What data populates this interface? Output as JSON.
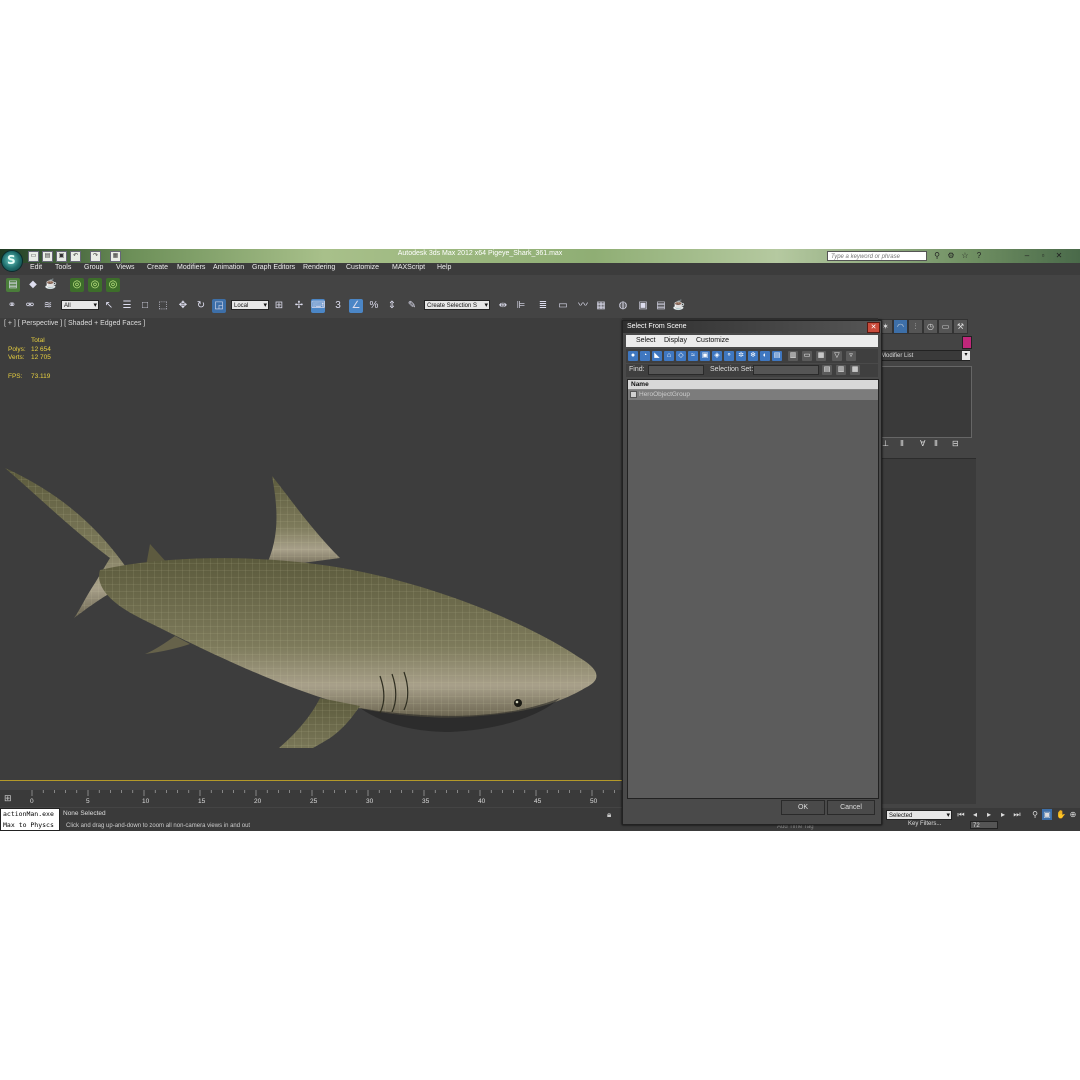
{
  "window": {
    "title": "Autodesk 3ds Max  2012 x64      Pigeye_Shark_361.max",
    "search_placeholder": "Type a keyword or phrase"
  },
  "menu": [
    "Edit",
    "Tools",
    "Group",
    "Views",
    "Create",
    "Modifiers",
    "Animation",
    "Graph Editors",
    "Rendering",
    "Customize",
    "MAXScript",
    "Help"
  ],
  "toolbar": {
    "filter_value": "All",
    "coord_value": "Local",
    "selection_set_placeholder": "Create Selection S"
  },
  "viewport": {
    "label": "[ + ] [ Perspective ] [ Shaded + Edged Faces ]",
    "stats": {
      "total_label": "Total",
      "polys_label": "Polys:",
      "polys_value": "12 654",
      "verts_label": "Verts:",
      "verts_value": "12 705",
      "fps_label": "FPS:",
      "fps_value": "73.119"
    }
  },
  "command_panel": {
    "modifier_list": "Modifier List"
  },
  "dialog": {
    "title": "Select From Scene",
    "menu": [
      "Select",
      "Display",
      "Customize"
    ],
    "find_label": "Find:",
    "selection_set_label": "Selection Set:",
    "column_name": "Name",
    "items": [
      "HeroObjectGroup"
    ],
    "ok_label": "OK",
    "cancel_label": "Cancel"
  },
  "timeline": {
    "ticks": [
      "0",
      "5",
      "10",
      "15",
      "20",
      "25",
      "30",
      "35",
      "40",
      "45",
      "50"
    ]
  },
  "status": {
    "maxscript_line1": "actionMan.exe",
    "maxscript_line2": "Max to Physcs",
    "selection": "None Selected",
    "prompt": "Click and drag up-and-down to zoom all non-camera views in and out",
    "add_time_tag": "Add Time Tag",
    "selected_dd": "Selected",
    "key_filters": "Key Filters...",
    "frame": "72"
  }
}
